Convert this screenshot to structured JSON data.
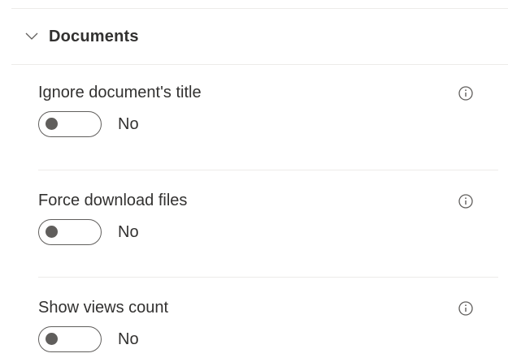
{
  "section": {
    "title": "Documents",
    "expanded": true,
    "chevron_icon": "chevron-down-icon"
  },
  "settings": [
    {
      "label": "Ignore document's title",
      "state_label": "No",
      "on": false,
      "info_icon": "info-icon"
    },
    {
      "label": "Force download files",
      "state_label": "No",
      "on": false,
      "info_icon": "info-icon"
    },
    {
      "label": "Show views count",
      "state_label": "No",
      "on": false,
      "info_icon": "info-icon"
    }
  ],
  "colors": {
    "text": "#323130",
    "divider": "#edebe9",
    "toggle_off": "#605e5c"
  }
}
